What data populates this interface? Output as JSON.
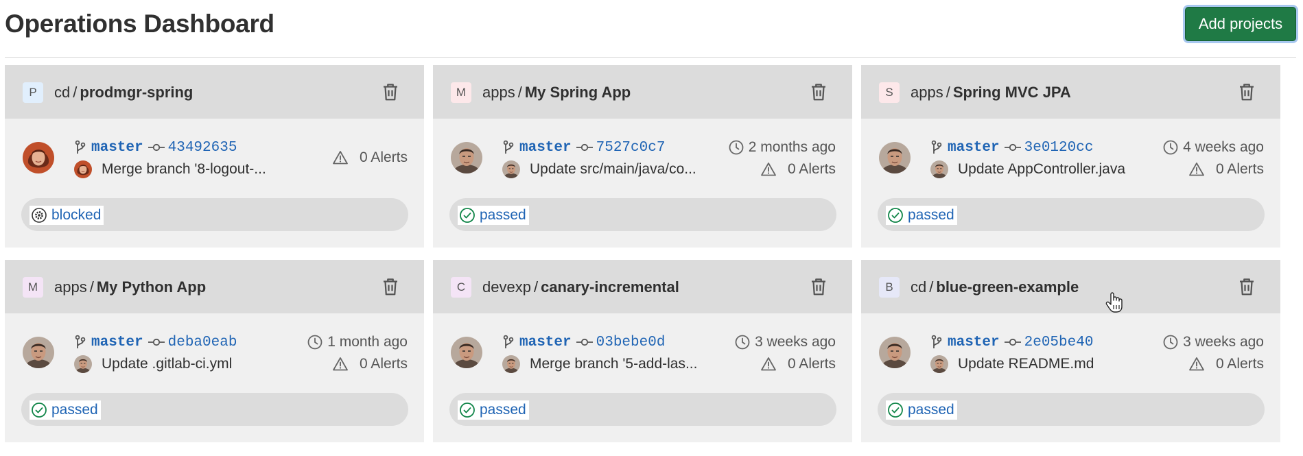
{
  "page": {
    "title": "Operations Dashboard",
    "add_button": "Add projects"
  },
  "colors": {
    "brand_button": "#1f7a45",
    "link_blue": "#1f64b4",
    "passed_green": "#108548",
    "card_bg": "#f0f0f0",
    "card_header_bg": "#dcdcdc"
  },
  "projects": [
    {
      "avatar_letter": "P",
      "avatar_color": "#e1effd",
      "namespace": "cd",
      "separator": "/",
      "name": "prodmgr-spring",
      "branch": "master",
      "sha": "43492635",
      "commit_message": "Merge branch '8-logout-...",
      "last_deployed": "",
      "alerts": "0 Alerts",
      "status": "blocked",
      "status_icon": "blocked-gear-icon",
      "author_avatar": "woman-avatar"
    },
    {
      "avatar_letter": "M",
      "avatar_color": "#fde8ea",
      "namespace": "apps",
      "separator": "/",
      "name": "My Spring App",
      "branch": "master",
      "sha": "7527c0c7",
      "commit_message": "Update src/main/java/co...",
      "last_deployed": "2 months ago",
      "alerts": "0 Alerts",
      "status": "passed",
      "status_icon": "passed-check-icon",
      "author_avatar": "man-avatar"
    },
    {
      "avatar_letter": "S",
      "avatar_color": "#fde8ea",
      "namespace": "apps",
      "separator": "/",
      "name": "Spring MVC JPA",
      "branch": "master",
      "sha": "3e0120cc",
      "commit_message": "Update AppController.java",
      "last_deployed": "4 weeks ago",
      "alerts": "0 Alerts",
      "status": "passed",
      "status_icon": "passed-check-icon",
      "author_avatar": "man-avatar"
    },
    {
      "avatar_letter": "M",
      "avatar_color": "#f4e4f6",
      "namespace": "apps",
      "separator": "/",
      "name": "My Python App",
      "branch": "master",
      "sha": "deba0eab",
      "commit_message": "Update .gitlab-ci.yml",
      "last_deployed": "1 month ago",
      "alerts": "0 Alerts",
      "status": "passed",
      "status_icon": "passed-check-icon",
      "author_avatar": "man-avatar"
    },
    {
      "avatar_letter": "C",
      "avatar_color": "#f4e4f6",
      "namespace": "devexp",
      "separator": "/",
      "name": "canary-incremental",
      "branch": "master",
      "sha": "03bebe0d",
      "commit_message": "Merge branch '5-add-las...",
      "last_deployed": "3 weeks ago",
      "alerts": "0 Alerts",
      "status": "passed",
      "status_icon": "passed-check-icon",
      "author_avatar": "man-avatar"
    },
    {
      "avatar_letter": "B",
      "avatar_color": "#e6e8f8",
      "namespace": "cd",
      "separator": "/",
      "name": "blue-green-example",
      "branch": "master",
      "sha": "2e05be40",
      "commit_message": "Update README.md",
      "last_deployed": "3 weeks ago",
      "alerts": "0 Alerts",
      "status": "passed",
      "status_icon": "passed-check-icon",
      "author_avatar": "man-avatar"
    }
  ]
}
